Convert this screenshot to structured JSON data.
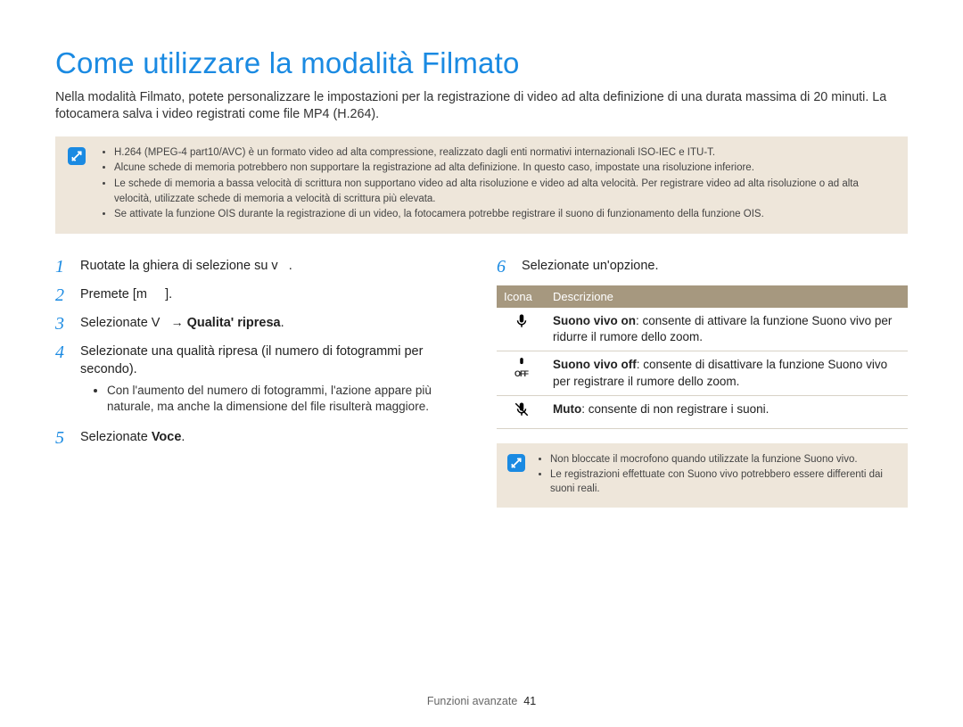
{
  "title": "Come utilizzare la modalità Filmato",
  "intro": "Nella modalità Filmato, potete personalizzare le impostazioni per la registrazione di video ad alta definizione di una durata massima di 20 minuti. La fotocamera salva i video registrati come file MP4 (H.264).",
  "top_notes": [
    "H.264 (MPEG-4 part10/AVC) è un formato video ad alta compressione, realizzato dagli enti normativi internazionali ISO-IEC e ITU-T.",
    "Alcune schede di memoria potrebbero non supportare la registrazione ad alta definizione. In questo caso, impostate una risoluzione inferiore.",
    "Le schede di memoria a bassa velocità di scrittura non supportano video ad alta risoluzione e video ad alta velocità. Per registrare video ad alta risoluzione o ad alta velocità, utilizzate schede di memoria a velocità di scrittura più elevata.",
    "Se attivate la funzione OIS durante la registrazione di un video, la fotocamera potrebbe registrare il suono di funzionamento della funzione OIS."
  ],
  "steps": {
    "s1": "Ruotate la ghiera di selezione su v   .",
    "s2": "Premete [m     ].",
    "s3_a": "Selezionate V",
    "s3_arrow": "→",
    "s3_b": "Qualita' ripresa",
    "s3_c": ".",
    "s4": "Selezionate una qualità ripresa (il numero di fotogrammi per secondo).",
    "s4_sub": "Con l'aumento del numero di fotogrammi, l'azione appare più naturale, ma anche la dimensione del file risulterà maggiore.",
    "s5_a": "Selezionate ",
    "s5_b": "Voce",
    "s5_c": ".",
    "s6": "Selezionate un'opzione."
  },
  "table": {
    "h_icon": "Icona",
    "h_desc": "Descrizione",
    "r1_bold": "Suono vivo on",
    "r1_rest": ": consente di attivare la funzione Suono vivo per ridurre il rumore dello zoom.",
    "r2_bold": "Suono vivo off",
    "r2_rest": ": consente di disattivare la funzione Suono vivo per registrare il rumore dello zoom.",
    "r3_bold": "Muto",
    "r3_rest": ": consente di non registrare i suoni."
  },
  "small_notes": [
    "Non bloccate il mocrofono quando utilizzate la funzione Suono vivo.",
    "Le registrazioni effettuate con Suono vivo potrebbero essere differenti dai suoni reali."
  ],
  "footer_section": "Funzioni avanzate",
  "footer_page": "41",
  "icons": {
    "info": "✎",
    "mic": "🎤",
    "mic_off_top": "🎤",
    "mic_off_bot": "OFF",
    "mute": "🔇"
  }
}
